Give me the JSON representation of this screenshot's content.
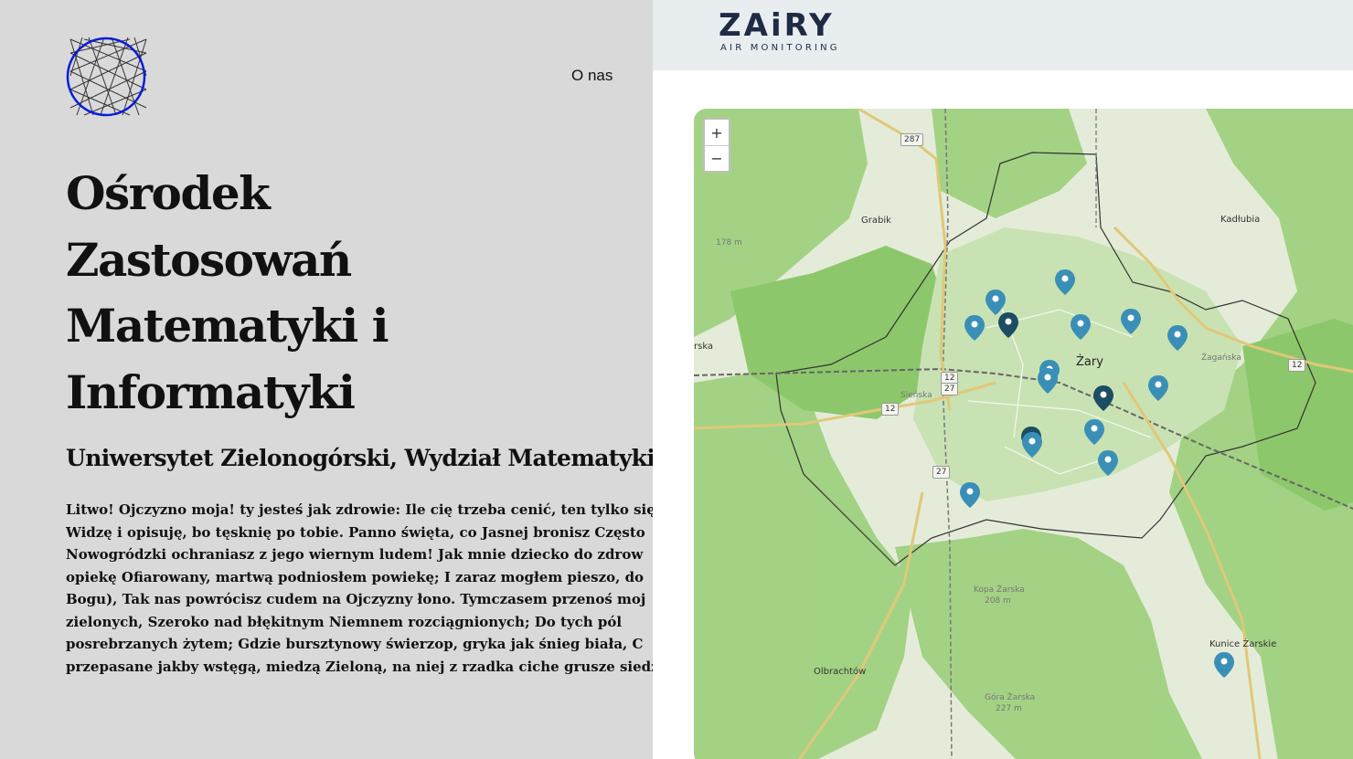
{
  "left": {
    "nav": {
      "about_label": "O nas"
    },
    "logo_icon": "sphere-globe-logo",
    "logo_color": "#0a1cd8",
    "title_lines": [
      "Ośrodek",
      "Zastosowań",
      "Matematyki i",
      "Informatyki"
    ],
    "subtitle": "Uniwersytet Zielonogórski, Wydział Matematyki,",
    "body_lines": [
      "Litwo! Ojczyzno moja! ty jesteś jak zdrowie: Ile cię trzeba cenić, ten tylko się",
      "Widzę i opisuję, bo tęsknię po tobie. Panno święta, co Jasnej bronisz Często",
      "Nowogródzki ochraniasz z jego wiernym ludem! Jak mnie dziecko do zdrow",
      "opiekę Ofiarowany, martwą podniosłem powiekę; I zaraz mogłem pieszo, do",
      "Bogu), Tak nas powrócisz cudem na Ojczyzny łono. Tymczasem przenoś moj",
      "zielonych, Szeroko nad błękitnym Niemnem rozciągnionych; Do tych pól",
      "posrebrzanych żytem; Gdzie bursztynowy świerzop, gryka jak śnieg biała, C",
      "przepasane jakby wstęgą, miedzą Zieloną, na niej z rzadka ciche grusze siedzą"
    ]
  },
  "right": {
    "brand": "ZAiRY",
    "brand_tagline": "AIR MONITORING",
    "brand_color": "#1f2a44",
    "header_bg": "#e8eef0",
    "map": {
      "zoom_in_label": "+",
      "zoom_out_label": "−",
      "places": {
        "city": "Żary",
        "grabik": "Grabik",
        "kadlubia": "Kadłubia",
        "olbrachtow": "Olbrachtów",
        "kunice": "Kunice Żarskie",
        "kopa": "Kopa Żarska",
        "kopa_elev": "208 m",
        "gora": "Góra Żarska",
        "gora_elev": "227 m",
        "elev_178": "178 m",
        "ska": "rska"
      },
      "roads": {
        "r287": "287",
        "r12a": "12",
        "r12b": "12",
        "r12c": "12",
        "r27a": "27",
        "r27b": "27",
        "street_zaganska": "Żagańska",
        "street_sienska": "Sieńska"
      },
      "marker_colors": {
        "standard": "#3a8fb7",
        "dark": "#1d4d63"
      },
      "forest_color": "#8cc86b",
      "markers_count": 17
    }
  }
}
